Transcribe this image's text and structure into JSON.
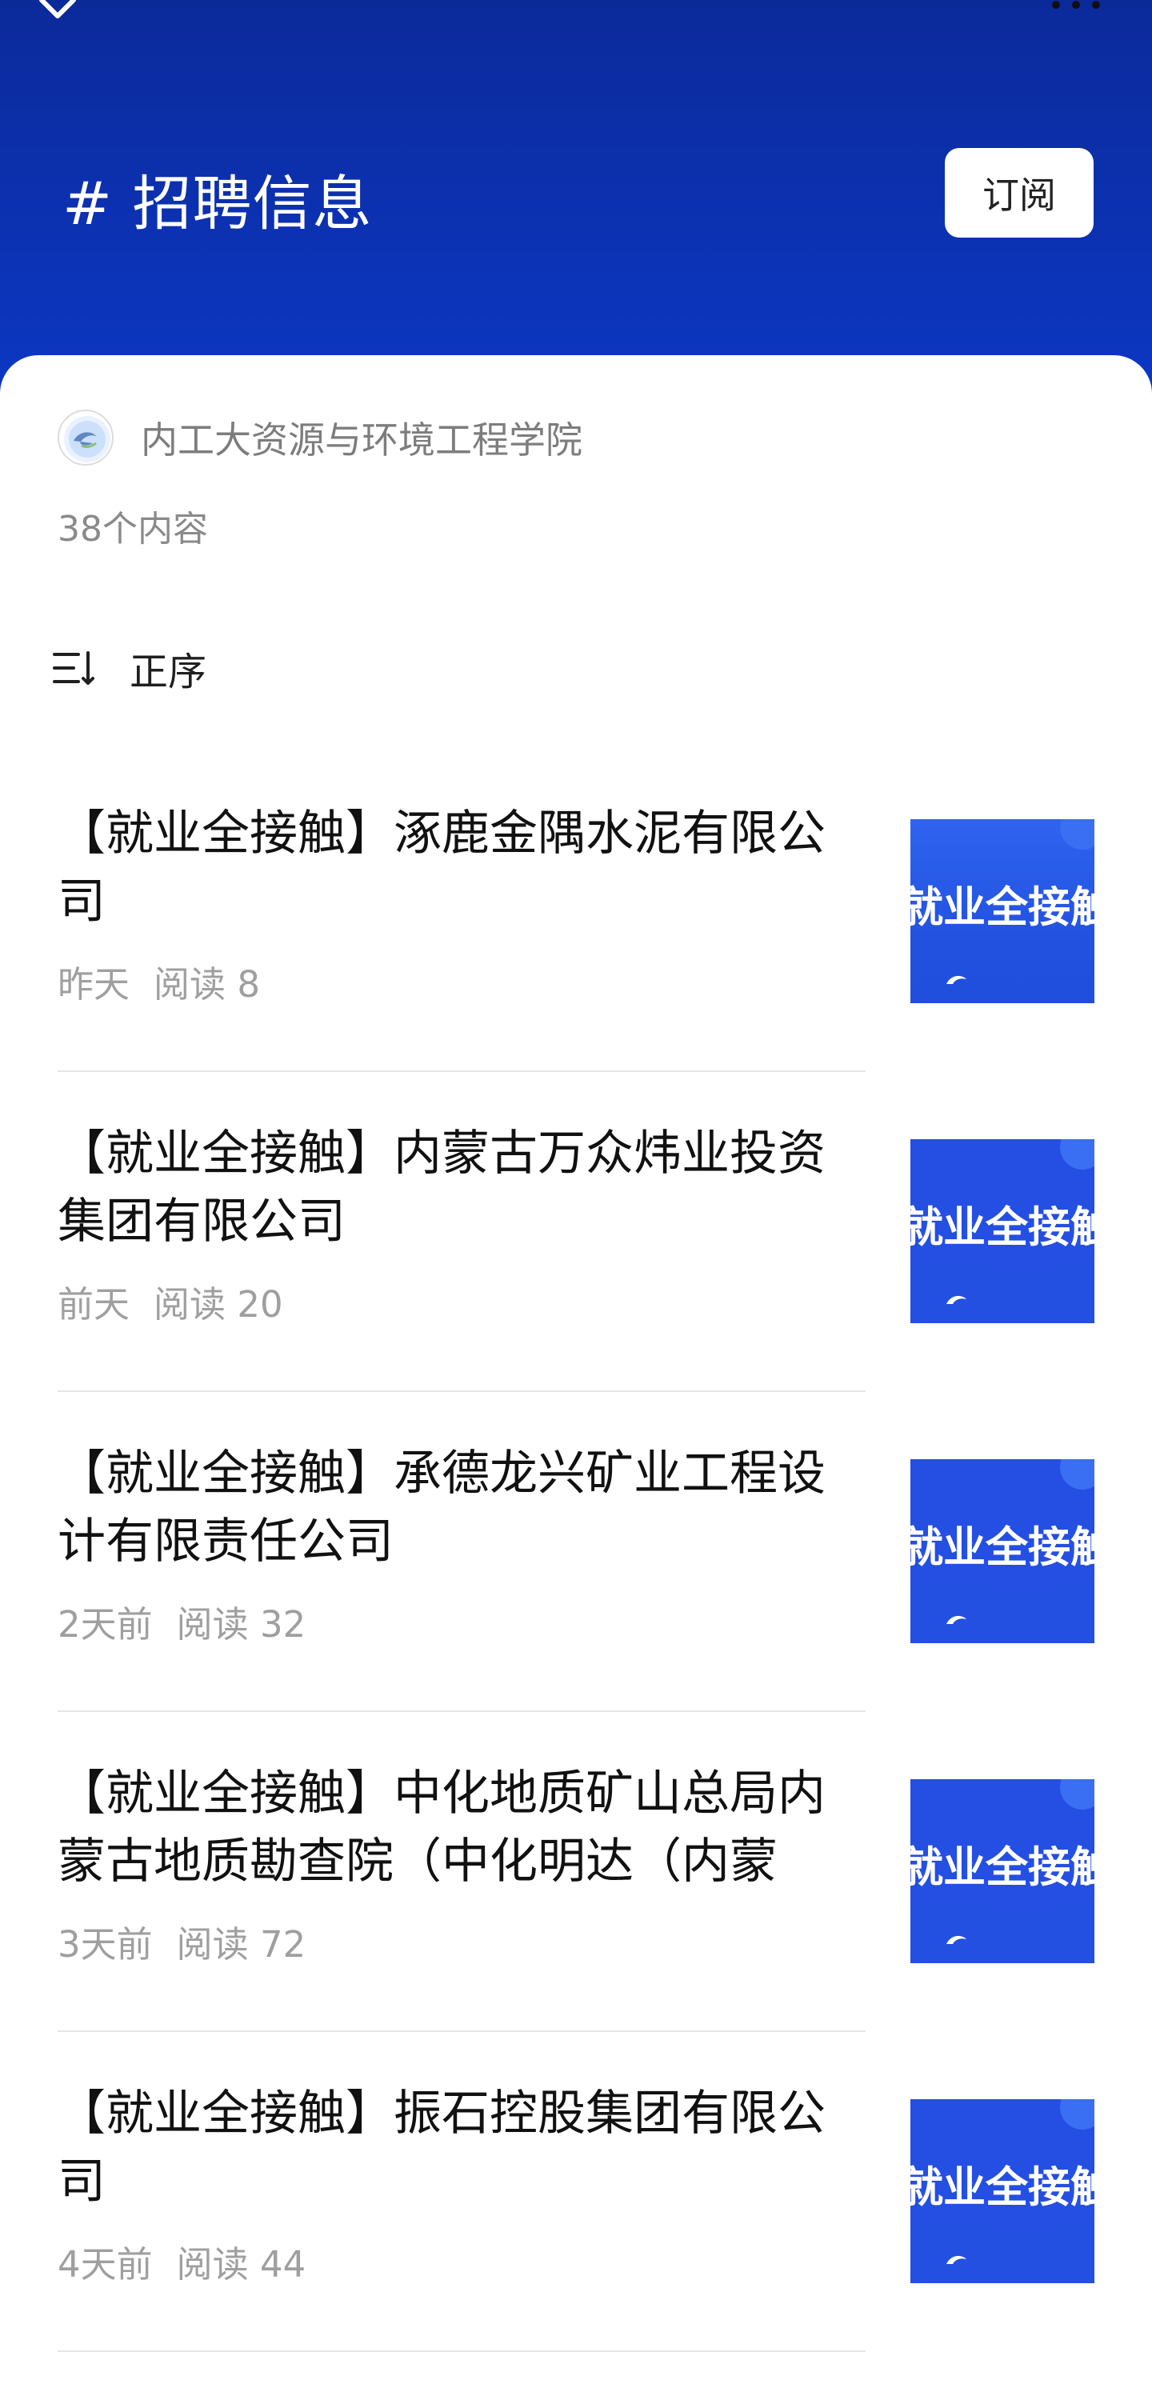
{
  "header": {
    "title": "# 招聘信息",
    "subscribe_label": "订阅",
    "colors": {
      "gradient_top": "#0b2a9a",
      "gradient_bottom": "#0d39c9"
    }
  },
  "publisher": {
    "name": "内工大资源与环境工程学院",
    "content_count": "38个内容"
  },
  "sort": {
    "label": "正序"
  },
  "thumb": {
    "text": "就业全接触"
  },
  "articles": [
    {
      "title": "【就业全接触】涿鹿金隅水泥有限公司",
      "time": "昨天",
      "reads": "阅读 8"
    },
    {
      "title": "【就业全接触】内蒙古万众炜业投资集团有限公司",
      "time": "前天",
      "reads": "阅读 20"
    },
    {
      "title": "【就业全接触】承德龙兴矿业工程设计有限责任公司",
      "time": "2天前",
      "reads": "阅读 32"
    },
    {
      "title": "【就业全接触】中化地质矿山总局内蒙古地质勘查院（中化明达（内蒙",
      "time": "3天前",
      "reads": "阅读 72"
    },
    {
      "title": "【就业全接触】振石控股集团有限公司",
      "time": "4天前",
      "reads": "阅读 44"
    }
  ]
}
